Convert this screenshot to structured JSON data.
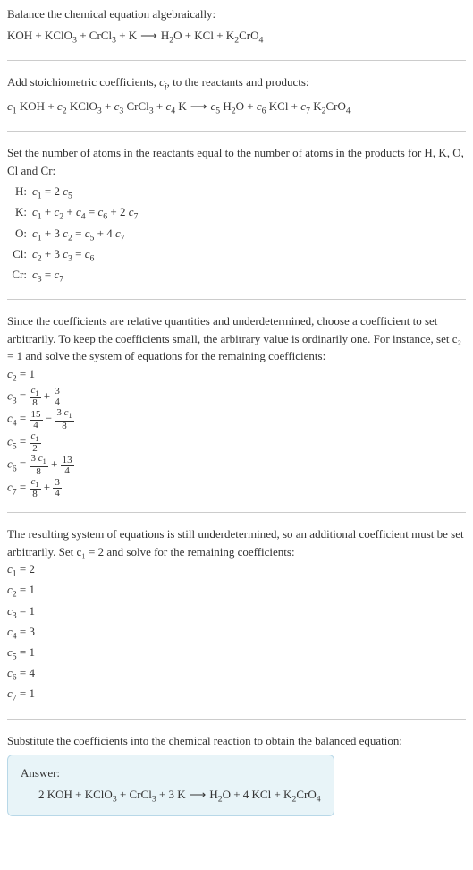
{
  "chart_data": {
    "type": "table",
    "title": "Balance the chemical equation algebraically",
    "reaction_unbalanced": {
      "reactants": [
        "KOH",
        "KClO3",
        "CrCl3",
        "K"
      ],
      "products": [
        "H2O",
        "KCl",
        "K2CrO4"
      ]
    },
    "stoich_coefficients": [
      "c1",
      "c2",
      "c3",
      "c4",
      "c5",
      "c6",
      "c7"
    ],
    "atom_equations": [
      {
        "element": "H",
        "equation": "c1 = 2 c5"
      },
      {
        "element": "K",
        "equation": "c1 + c2 + c4 = c6 + 2 c7"
      },
      {
        "element": "O",
        "equation": "c1 + 3 c2 = c5 + 4 c7"
      },
      {
        "element": "Cl",
        "equation": "c2 + 3 c3 = c6"
      },
      {
        "element": "Cr",
        "equation": "c3 = c7"
      }
    ],
    "set_c2": 1,
    "partial_solution": {
      "c2": "1",
      "c3": "c1/8 + 3/4",
      "c4": "15/4 - 3c1/8",
      "c5": "c1/2",
      "c6": "3c1/8 + 13/4",
      "c7": "c1/8 + 3/4"
    },
    "set_c1": 2,
    "final_coefficients": {
      "c1": 2,
      "c2": 1,
      "c3": 1,
      "c4": 3,
      "c5": 1,
      "c6": 4,
      "c7": 1
    },
    "balanced_equation": "2 KOH + KClO3 + CrCl3 + 3 K ⟶ H2O + 4 KCl + K2CrO4"
  },
  "s1": {
    "line1": "Balance the chemical equation algebraically:"
  },
  "s2": {
    "text": "Add stoichiometric coefficients, c_i, to the reactants and products:"
  },
  "s3": {
    "text": "Set the number of atoms in the reactants equal to the number of atoms in the products for H, K, O, Cl and Cr:",
    "rows": [
      {
        "label": "H:",
        "eq": "c₁ = 2 c₅"
      },
      {
        "label": "K:",
        "eq": "c₁ + c₂ + c₄ = c₆ + 2 c₇"
      },
      {
        "label": "O:",
        "eq": "c₁ + 3 c₂ = c₅ + 4 c₇"
      },
      {
        "label": "Cl:",
        "eq": "c₂ + 3 c₃ = c₆"
      },
      {
        "label": "Cr:",
        "eq": "c₃ = c₇"
      }
    ]
  },
  "s4": {
    "text": "Since the coefficients are relative quantities and underdetermined, choose a coefficient to set arbitrarily. To keep the coefficients small, the arbitrary value is ordinarily one. For instance, set c₂ = 1 and solve the system of equations for the remaining coefficients:",
    "c2": "c₂ = 1",
    "c3": {
      "lhs": "c₃ = ",
      "n1": "c₁",
      "d1": "8",
      "plus": " + ",
      "n2": "3",
      "d2": "4"
    },
    "c4": {
      "lhs": "c₄ = ",
      "n1": "15",
      "d1": "4",
      "minus": " − ",
      "n2": "3 c₁",
      "d2": "8"
    },
    "c5": {
      "lhs": "c₅ = ",
      "n1": "c₁",
      "d1": "2"
    },
    "c6": {
      "lhs": "c₆ = ",
      "n1": "3 c₁",
      "d1": "8",
      "plus": " + ",
      "n2": "13",
      "d2": "4"
    },
    "c7": {
      "lhs": "c₇ = ",
      "n1": "c₁",
      "d1": "8",
      "plus": " + ",
      "n2": "3",
      "d2": "4"
    }
  },
  "s5": {
    "text": "The resulting system of equations is still underdetermined, so an additional coefficient must be set arbitrarily. Set c₁ = 2 and solve for the remaining coefficients:",
    "rows": [
      "c₁ = 2",
      "c₂ = 1",
      "c₃ = 1",
      "c₄ = 3",
      "c₅ = 1",
      "c₆ = 4",
      "c₇ = 1"
    ]
  },
  "s6": {
    "text": "Substitute the coefficients into the chemical reaction to obtain the balanced equation:",
    "answer_label": "Answer:"
  }
}
